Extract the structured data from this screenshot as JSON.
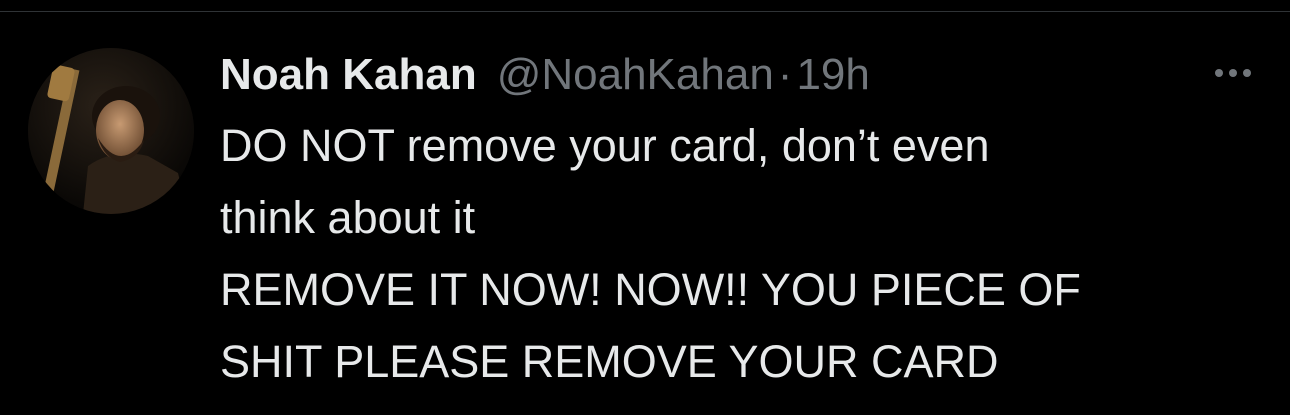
{
  "tweet": {
    "author": {
      "display_name": "Noah Kahan",
      "handle": "@NoahKahan"
    },
    "separator": "·",
    "timestamp": "19h",
    "text_lines": [
      "DO NOT remove your card, don’t even",
      "think about it",
      "REMOVE IT NOW! NOW!! YOU PIECE OF",
      "SHIT PLEASE REMOVE YOUR CARD"
    ],
    "more_icon": "more-horizontal-icon"
  },
  "colors": {
    "background": "#000000",
    "primary_text": "#e7e9ea",
    "secondary_text": "#71767b",
    "divider": "#2f3336"
  }
}
